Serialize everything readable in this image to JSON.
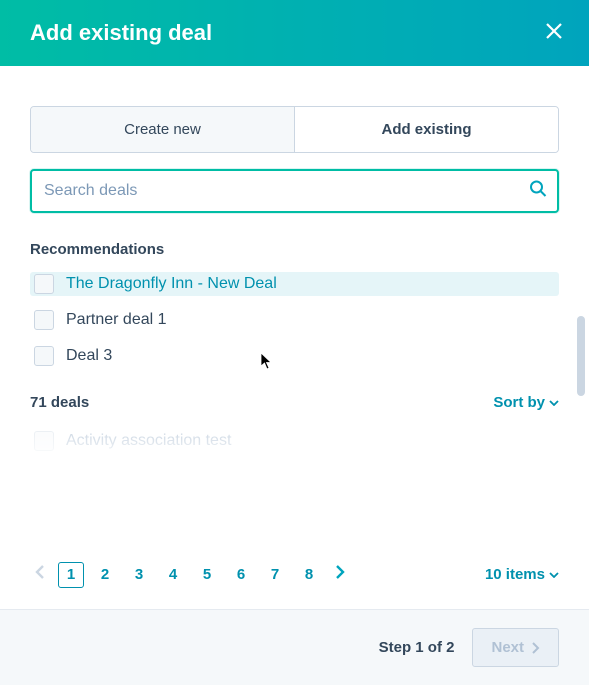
{
  "header": {
    "title": "Add existing deal"
  },
  "tabs": {
    "create": "Create new",
    "existing": "Add existing"
  },
  "search": {
    "placeholder": "Search deals",
    "value": ""
  },
  "recommendations": {
    "label": "Recommendations",
    "items": [
      {
        "label": "The Dragonfly Inn - New Deal",
        "hover": true
      },
      {
        "label": "Partner deal 1",
        "hover": false
      },
      {
        "label": "Deal 3",
        "hover": false
      }
    ]
  },
  "deals": {
    "count_label": "71 deals",
    "sort_label": "Sort by",
    "peek_item": "Activity association test"
  },
  "pagination": {
    "pages": [
      "1",
      "2",
      "3",
      "4",
      "5",
      "6",
      "7",
      "8"
    ],
    "current": "1",
    "items_label": "10 items"
  },
  "footer": {
    "step_label": "Step 1 of 2",
    "next_label": "Next"
  }
}
